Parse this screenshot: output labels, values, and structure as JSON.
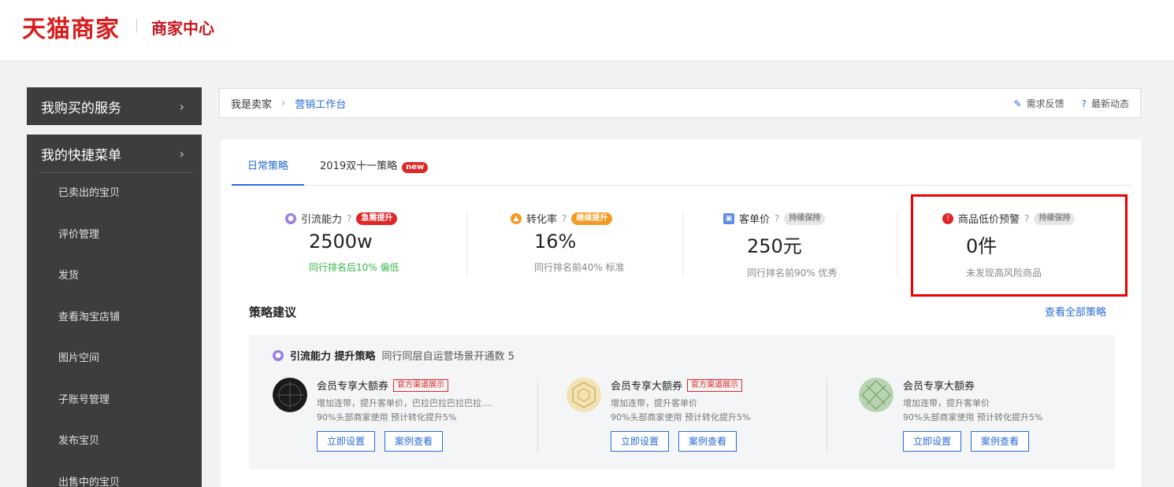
{
  "header": {
    "brand": "天猫商家",
    "subtitle": "商家中心"
  },
  "sidebar": {
    "services": "我购买的服务",
    "quick_menu": "我的快捷菜单",
    "items": [
      "已卖出的宝贝",
      "评价管理",
      "发货",
      "查看淘宝店铺",
      "图片空间",
      "子账号管理",
      "发布宝贝",
      "出售中的宝贝"
    ]
  },
  "breadcrumb": {
    "root": "我是卖家",
    "current": "营销工作台",
    "feedback": "需求反馈",
    "news": "最新动态"
  },
  "tabs": [
    {
      "label": "日常策略"
    },
    {
      "label": "2019双十一策略",
      "badge": "new"
    }
  ],
  "metrics": [
    {
      "label": "引流能力",
      "tag": "急需提升",
      "value": "2500w",
      "sub": "同行排名后10% 偏低",
      "tag_color": "#e02727",
      "icon_color": "#9b7fe0"
    },
    {
      "label": "转化率",
      "tag": "继续提升",
      "value": "16%",
      "sub": "同行排名前40% 标准",
      "tag_color": "#f59a23",
      "icon_color": "#f59a23"
    },
    {
      "label": "客单价",
      "tag": "持续保持",
      "value": "250元",
      "sub": "同行排名前90% 优秀",
      "tag_color": "#d9d9d9",
      "icon_color": "#5b8ee6"
    },
    {
      "label": "商品低价预警",
      "tag": "持续保持",
      "value": "0件",
      "sub": "未发现高风险商品",
      "tag_color": "#d9d9d9",
      "icon_color": "#e02727"
    }
  ],
  "strategy": {
    "title": "策略建议",
    "view_all": "查看全部策略",
    "head_bold": "引流能力 提升策略",
    "head_note": "同行同层自运营场景开通数 5",
    "coupons": [
      {
        "title": "会员专享大额券",
        "badge": "官方渠道展示",
        "desc1": "增加连带，提升客单价，巴拉巴拉巴拉巴拉....",
        "desc2": "90%头部商家使用 预计转化提升5%",
        "btn1": "立即设置",
        "btn2": "案例查看"
      },
      {
        "title": "会员专享大额券",
        "badge": "官方渠道展示",
        "desc1": "增加连带，提升客单价",
        "desc2": "90%头部商家使用 预计转化提升5%",
        "btn1": "立即设置",
        "btn2": "案例查看"
      },
      {
        "title": "会员专享大额券",
        "badge": "",
        "desc1": "增加连带，提升客单价",
        "desc2": "90%头部商家使用 预计转化提升5%",
        "btn1": "立即设置",
        "btn2": "案例查看"
      }
    ]
  }
}
